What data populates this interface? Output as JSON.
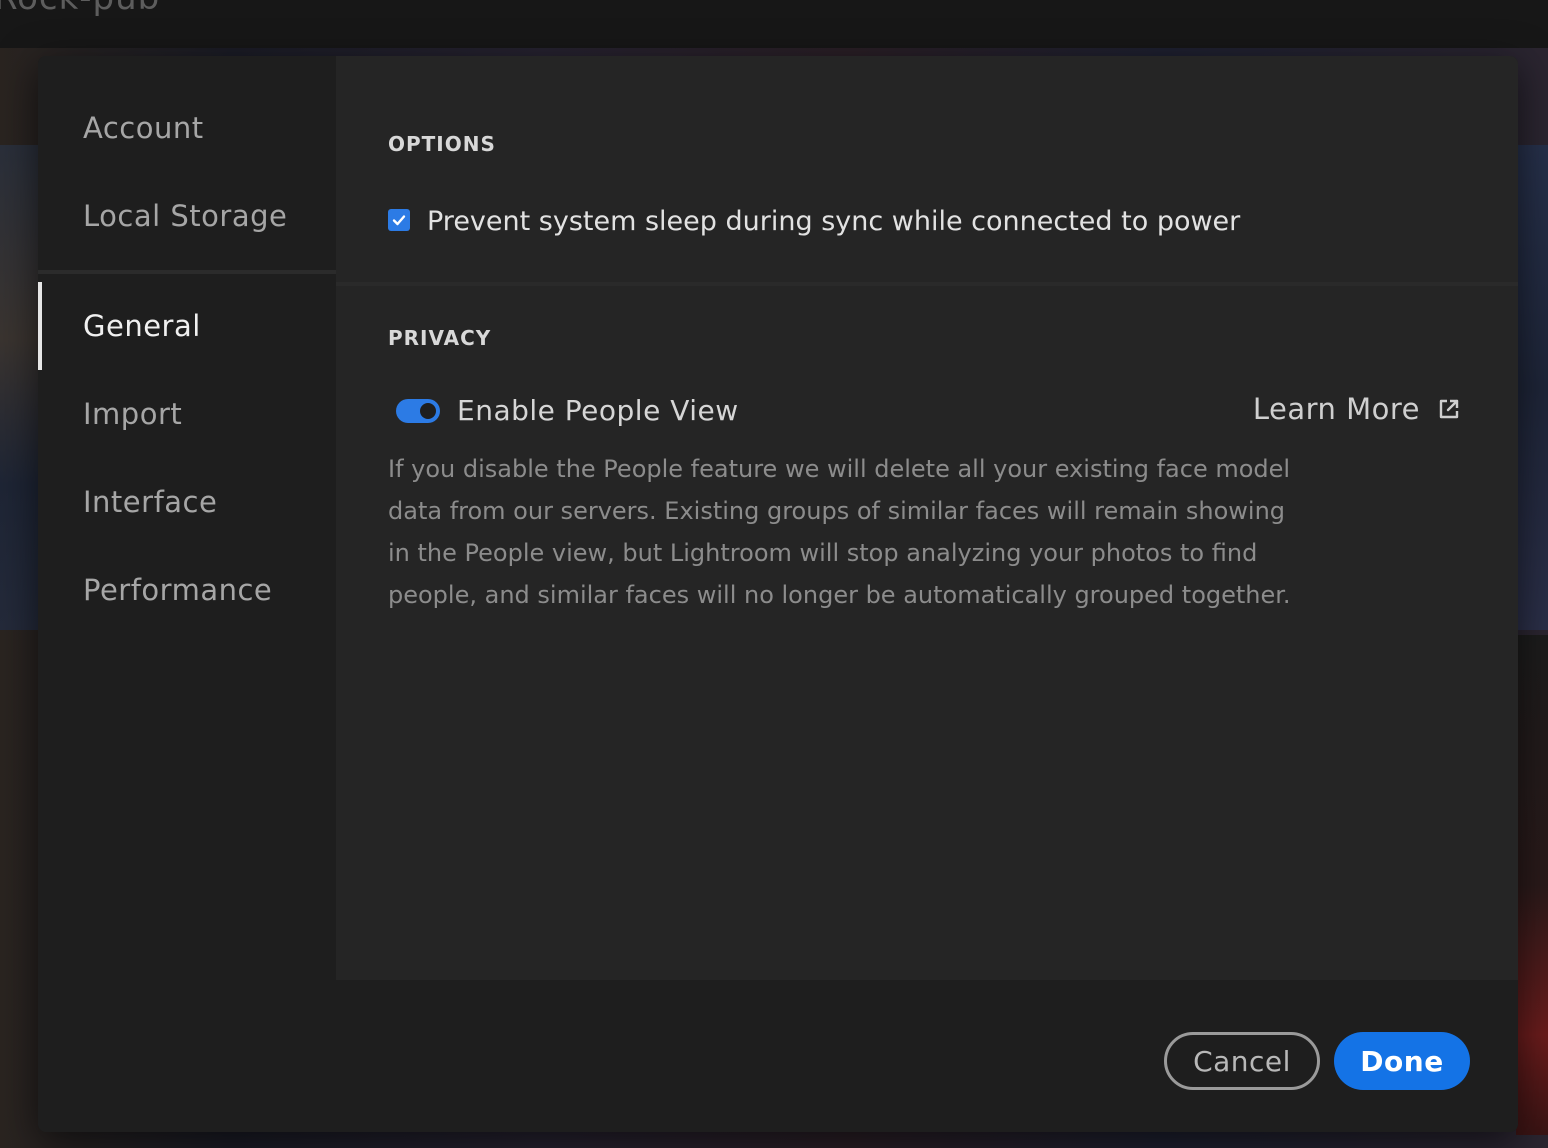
{
  "background": {
    "title": "Rock-pub"
  },
  "sidebar": {
    "items_top": [
      {
        "label": "Account"
      },
      {
        "label": "Local Storage"
      }
    ],
    "items_bottom": [
      {
        "label": "General",
        "active": true
      },
      {
        "label": "Import"
      },
      {
        "label": "Interface"
      },
      {
        "label": "Performance"
      }
    ]
  },
  "options": {
    "heading": "OPTIONS",
    "prevent_sleep": {
      "label": "Prevent system sleep during sync while connected to power",
      "checked": true
    }
  },
  "privacy": {
    "heading": "PRIVACY",
    "people_view": {
      "label": "Enable People View",
      "enabled": true
    },
    "learn_more": "Learn More",
    "description": "If you disable the People feature we will delete all your existing face model data from our servers. Existing groups of similar faces will remain showing in the People view, but Lightroom will stop analyzing your photos to find people, and similar faces will no longer be automatically grouped together."
  },
  "footer": {
    "cancel_label": "Cancel",
    "done_label": "Done"
  },
  "colors": {
    "accent": "#1473e6",
    "checkbox": "#2c7be5"
  },
  "icons": {
    "checkbox": "checkmark-icon",
    "external_link": "external-link-icon"
  }
}
